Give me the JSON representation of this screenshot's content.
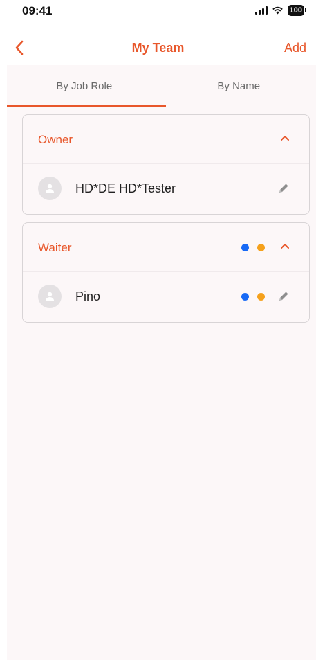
{
  "status_bar": {
    "time": "09:41",
    "battery": "100",
    "icons": [
      "signal-icon",
      "wifi-icon",
      "battery-icon"
    ]
  },
  "nav": {
    "back_icon": "chevron-left-icon",
    "title": "My Team",
    "add_label": "Add"
  },
  "tabs": [
    {
      "label": "By Job Role",
      "selected": true
    },
    {
      "label": "By Name",
      "selected": false
    }
  ],
  "groups": [
    {
      "title": "Owner",
      "expanded": true,
      "dot_colors": [],
      "members": [
        {
          "name": "HD*DE HD*Tester",
          "dot_colors": []
        }
      ]
    },
    {
      "title": "Waiter",
      "expanded": true,
      "dot_colors": [
        "#1769f5",
        "#f5a11c"
      ],
      "members": [
        {
          "name": "Pino",
          "dot_colors": [
            "#1769f5",
            "#f5a11c"
          ]
        }
      ]
    }
  ],
  "colors": {
    "accent": "#e8572b",
    "content_bg": "#fcf7f8",
    "dot_blue": "#1769f5",
    "dot_orange": "#f5a11c"
  }
}
